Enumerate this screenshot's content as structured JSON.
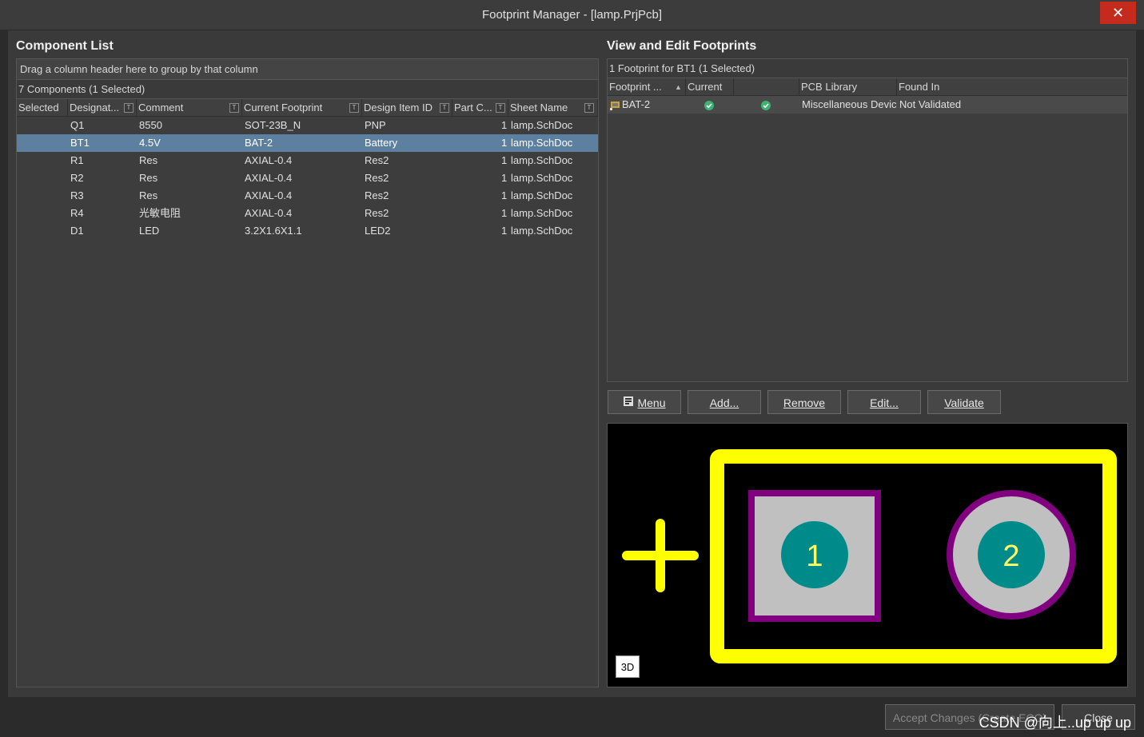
{
  "window": {
    "title": "Footprint Manager - [lamp.PrjPcb]",
    "close_glyph": "✕"
  },
  "left": {
    "title": "Component List",
    "group_hint": "Drag a column header here to group by that column",
    "count": "7 Components (1 Selected)",
    "columns": [
      "Selected",
      "Designat...",
      "Comment",
      "Current Footprint",
      "Design Item ID",
      "Part C...",
      "Sheet Name"
    ],
    "rows": [
      {
        "selected": "",
        "designator": "Q1",
        "comment": "8550",
        "footprint": "SOT-23B_N",
        "design_item_id": "PNP",
        "part_count": "1",
        "sheet": "lamp.SchDoc"
      },
      {
        "selected": "",
        "designator": "BT1",
        "comment": "4.5V",
        "footprint": "BAT-2",
        "design_item_id": "Battery",
        "part_count": "1",
        "sheet": "lamp.SchDoc"
      },
      {
        "selected": "",
        "designator": "R1",
        "comment": "Res",
        "footprint": "AXIAL-0.4",
        "design_item_id": "Res2",
        "part_count": "1",
        "sheet": "lamp.SchDoc"
      },
      {
        "selected": "",
        "designator": "R2",
        "comment": "Res",
        "footprint": "AXIAL-0.4",
        "design_item_id": "Res2",
        "part_count": "1",
        "sheet": "lamp.SchDoc"
      },
      {
        "selected": "",
        "designator": "R3",
        "comment": "Res",
        "footprint": "AXIAL-0.4",
        "design_item_id": "Res2",
        "part_count": "1",
        "sheet": "lamp.SchDoc"
      },
      {
        "selected": "",
        "designator": "R4",
        "comment": "光敏电阻",
        "footprint": "AXIAL-0.4",
        "design_item_id": "Res2",
        "part_count": "1",
        "sheet": "lamp.SchDoc"
      },
      {
        "selected": "",
        "designator": "D1",
        "comment": "LED",
        "footprint": "3.2X1.6X1.1",
        "design_item_id": "LED2",
        "part_count": "1",
        "sheet": "lamp.SchDoc"
      }
    ]
  },
  "right": {
    "title": "View and Edit Footprints",
    "count": "1 Footprint for BT1 (1 Selected)",
    "columns": [
      "Footprint ...",
      "Current",
      "",
      "PCB Library",
      "Found In"
    ],
    "rows": [
      {
        "footprint": "BAT-2",
        "current": "check",
        "extra": "check",
        "library": "Miscellaneous Devic",
        "found_in": "Not Validated"
      }
    ],
    "buttons": {
      "menu": "Menu",
      "add": "Add...",
      "remove": "Remove",
      "edit": "Edit...",
      "validate": "Validate"
    },
    "preview": {
      "pad1": "1",
      "pad2": "2",
      "badge": "3D"
    }
  },
  "footer": {
    "accept": "Accept Changes (Create ECO)",
    "close": "Close",
    "watermark": "CSDN @向上..up up up"
  },
  "colors": {
    "selected_row": "#5d7fa0",
    "overlay": "#ffff00",
    "pad": "#c0c0c0",
    "pad_ring": "#800080",
    "hole": "#008b8b"
  }
}
